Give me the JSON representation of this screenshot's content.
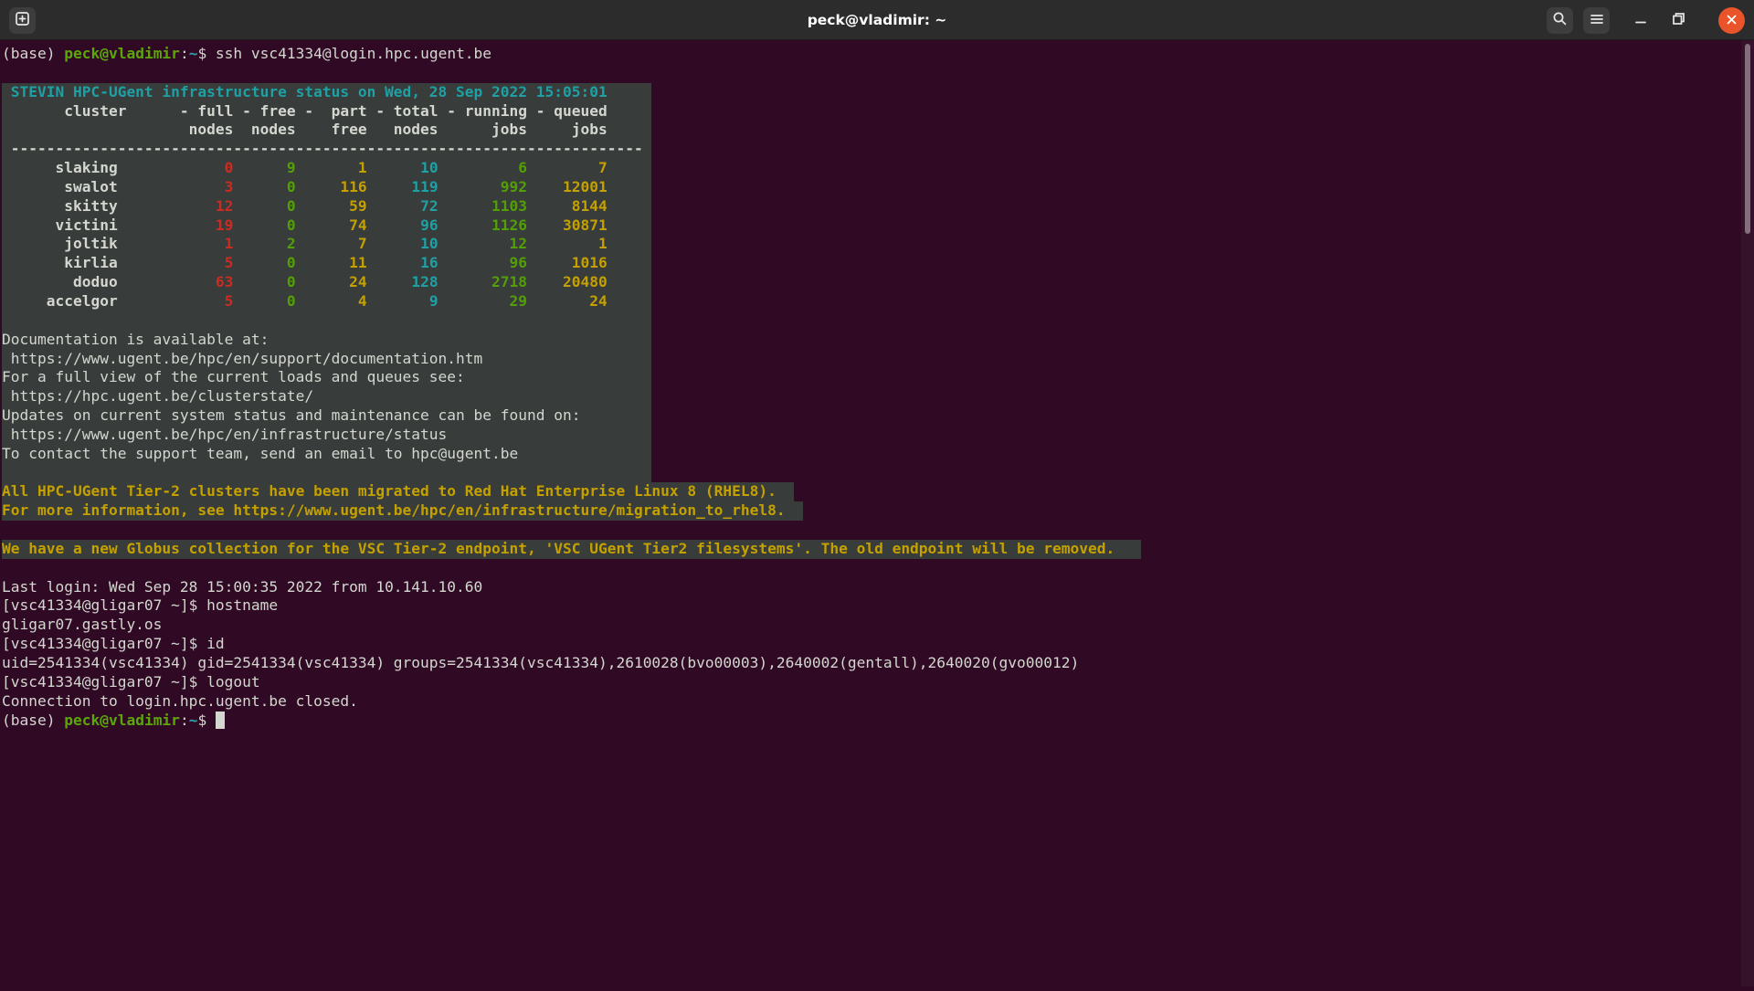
{
  "window": {
    "title": "peck@vladimir: ~",
    "icons": {
      "new_tab": "new-tab",
      "search": "magnifier",
      "menu": "hamburger",
      "minimize": "minus-bar",
      "restore": "overlapping-squares",
      "close": "cross-in-orange-circle"
    }
  },
  "colors": {
    "term_bg": "#300a24",
    "title_bg": "#2c2c2c",
    "btn_bg": "#3d3d3d",
    "icon": "#e8e8e8",
    "close_bg": "#e9542a",
    "block_bg": "#383c3a",
    "white": "#d3d7cf",
    "green": "#5ba708",
    "teal": "#2fa3a8",
    "cyan": "#1fa0a4",
    "red": "#cc2b22",
    "num_green": "#539f06",
    "yellow": "#c4a000"
  },
  "cluster_table": {
    "title": "STEVIN HPC-UGent infrastructure status on Wed, 28 Sep 2022 15:05:01",
    "columns": [
      "cluster",
      "full nodes",
      "free nodes",
      "part free",
      "total nodes",
      "running jobs",
      "queued jobs"
    ],
    "rows": [
      [
        "slaking",
        0,
        9,
        1,
        10,
        6,
        7
      ],
      [
        "swalot",
        3,
        0,
        116,
        119,
        992,
        12001
      ],
      [
        "skitty",
        12,
        0,
        59,
        72,
        1103,
        8144
      ],
      [
        "victini",
        19,
        0,
        74,
        96,
        1126,
        30871
      ],
      [
        "joltik",
        1,
        2,
        7,
        10,
        12,
        1
      ],
      [
        "kirlia",
        5,
        0,
        11,
        16,
        96,
        1016
      ],
      [
        "doduo",
        63,
        0,
        24,
        128,
        2718,
        20480
      ],
      [
        "accelgor",
        5,
        0,
        4,
        9,
        29,
        24
      ]
    ]
  },
  "terminal": {
    "lines": [
      {
        "s": [
          [
            "(base) ",
            "w"
          ],
          [
            "peck@vladimir",
            "g"
          ],
          [
            ":",
            "w"
          ],
          [
            "~",
            "t"
          ],
          [
            "$ ssh vsc41334@login.hpc.ugent.be",
            "w"
          ]
        ]
      },
      {
        "s": []
      },
      {
        "p": 73,
        "bg": true,
        "s": [
          [
            " STEVIN HPC-UGent infrastructure status on Wed, 28 Sep 2022 15:05:01",
            "c"
          ]
        ]
      },
      {
        "p": 73,
        "bg": true,
        "s": [
          [
            "       cluster      - full - free -  part - total - running - queued",
            "wb"
          ]
        ]
      },
      {
        "p": 73,
        "bg": true,
        "s": [
          [
            "                     nodes  nodes    free   nodes      jobs     jobs",
            "wb"
          ]
        ]
      },
      {
        "p": 73,
        "bg": true,
        "s": [
          [
            " -----------------------------------------------------------------------",
            "wb"
          ]
        ]
      },
      {
        "p": 73,
        "bg": true,
        "s": [
          [
            "      slaking",
            "wb"
          ],
          [
            "            0",
            "r"
          ],
          [
            "      9",
            "gn"
          ],
          [
            "       1",
            "y"
          ],
          [
            "      10",
            "c"
          ],
          [
            "         6",
            "gn"
          ],
          [
            "        7",
            "y"
          ]
        ]
      },
      {
        "p": 73,
        "bg": true,
        "s": [
          [
            "       swalot",
            "wb"
          ],
          [
            "            3",
            "r"
          ],
          [
            "      0",
            "gn"
          ],
          [
            "     116",
            "y"
          ],
          [
            "     119",
            "c"
          ],
          [
            "       992",
            "gn"
          ],
          [
            "    12001",
            "y"
          ]
        ]
      },
      {
        "p": 73,
        "bg": true,
        "s": [
          [
            "       skitty",
            "wb"
          ],
          [
            "           12",
            "r"
          ],
          [
            "      0",
            "gn"
          ],
          [
            "      59",
            "y"
          ],
          [
            "      72",
            "c"
          ],
          [
            "      1103",
            "gn"
          ],
          [
            "     8144",
            "y"
          ]
        ]
      },
      {
        "p": 73,
        "bg": true,
        "s": [
          [
            "      victini",
            "wb"
          ],
          [
            "           19",
            "r"
          ],
          [
            "      0",
            "gn"
          ],
          [
            "      74",
            "y"
          ],
          [
            "      96",
            "c"
          ],
          [
            "      1126",
            "gn"
          ],
          [
            "    30871",
            "y"
          ]
        ]
      },
      {
        "p": 73,
        "bg": true,
        "s": [
          [
            "       joltik",
            "wb"
          ],
          [
            "            1",
            "r"
          ],
          [
            "      2",
            "gn"
          ],
          [
            "       7",
            "y"
          ],
          [
            "      10",
            "c"
          ],
          [
            "        12",
            "gn"
          ],
          [
            "        1",
            "y"
          ]
        ]
      },
      {
        "p": 73,
        "bg": true,
        "s": [
          [
            "       kirlia",
            "wb"
          ],
          [
            "            5",
            "r"
          ],
          [
            "      0",
            "gn"
          ],
          [
            "      11",
            "y"
          ],
          [
            "      16",
            "c"
          ],
          [
            "        96",
            "gn"
          ],
          [
            "     1016",
            "y"
          ]
        ]
      },
      {
        "p": 73,
        "bg": true,
        "s": [
          [
            "        doduo",
            "wb"
          ],
          [
            "           63",
            "r"
          ],
          [
            "      0",
            "gn"
          ],
          [
            "      24",
            "y"
          ],
          [
            "     128",
            "c"
          ],
          [
            "      2718",
            "gn"
          ],
          [
            "    20480",
            "y"
          ]
        ]
      },
      {
        "p": 73,
        "bg": true,
        "s": [
          [
            "     accelgor",
            "wb"
          ],
          [
            "            5",
            "r"
          ],
          [
            "      0",
            "gn"
          ],
          [
            "       4",
            "y"
          ],
          [
            "       9",
            "c"
          ],
          [
            "        29",
            "gn"
          ],
          [
            "       24",
            "y"
          ]
        ]
      },
      {
        "p": 73,
        "bg": true,
        "s": []
      },
      {
        "p": 73,
        "bg": true,
        "s": [
          [
            "Documentation is available at:",
            "w"
          ]
        ]
      },
      {
        "p": 73,
        "bg": true,
        "s": [
          [
            " https://www.ugent.be/hpc/en/support/documentation.htm",
            "w"
          ]
        ]
      },
      {
        "p": 73,
        "bg": true,
        "s": [
          [
            "For a full view of the current loads and queues see:",
            "w"
          ]
        ]
      },
      {
        "p": 73,
        "bg": true,
        "s": [
          [
            " https://hpc.ugent.be/clusterstate/",
            "w"
          ]
        ]
      },
      {
        "p": 73,
        "bg": true,
        "s": [
          [
            "Updates on current system status and maintenance can be found on:",
            "w"
          ]
        ]
      },
      {
        "p": 73,
        "bg": true,
        "s": [
          [
            " https://www.ugent.be/hpc/en/infrastructure/status",
            "w"
          ]
        ]
      },
      {
        "p": 73,
        "bg": true,
        "s": [
          [
            "To contact the support team, send an email to hpc@ugent.be",
            "w"
          ]
        ]
      },
      {
        "p": 73,
        "bg": true,
        "s": []
      },
      {
        "p": 89,
        "bg": true,
        "s": [
          [
            "All HPC-UGent Tier-2 clusters have been migrated to Red Hat Enterprise Linux 8 (RHEL8).",
            "yb"
          ]
        ]
      },
      {
        "p": 90,
        "bg": true,
        "s": [
          [
            "For more information, see https://www.ugent.be/hpc/en/infrastructure/migration_to_rhel8.",
            "yb"
          ]
        ]
      },
      {
        "s": []
      },
      {
        "p": 128,
        "bg": true,
        "s": [
          [
            "We have a new Globus collection for the VSC Tier-2 endpoint, 'VSC UGent Tier2 filesystems'. The old endpoint will be removed.",
            "yb"
          ]
        ]
      },
      {
        "s": []
      },
      {
        "s": [
          [
            "Last login: Wed Sep 28 15:00:35 2022 from 10.141.10.60",
            "w"
          ]
        ]
      },
      {
        "s": [
          [
            "[vsc41334@gligar07 ~]$ hostname",
            "w"
          ]
        ]
      },
      {
        "s": [
          [
            "gligar07.gastly.os",
            "w"
          ]
        ]
      },
      {
        "s": [
          [
            "[vsc41334@gligar07 ~]$ id",
            "w"
          ]
        ]
      },
      {
        "s": [
          [
            "uid=2541334(vsc41334) gid=2541334(vsc41334) groups=2541334(vsc41334),2610028(bvo00003),2640002(gentall),2640020(gvo00012)",
            "w"
          ]
        ]
      },
      {
        "s": [
          [
            "[vsc41334@gligar07 ~]$ logout",
            "w"
          ]
        ]
      },
      {
        "s": [
          [
            "Connection to login.hpc.ugent.be closed.",
            "w"
          ]
        ]
      },
      {
        "s": [
          [
            "(base) ",
            "w"
          ],
          [
            "peck@vladimir",
            "g"
          ],
          [
            ":",
            "w"
          ],
          [
            "~",
            "t"
          ],
          [
            "$ ",
            "w"
          ]
        ],
        "cursor": true
      }
    ]
  }
}
